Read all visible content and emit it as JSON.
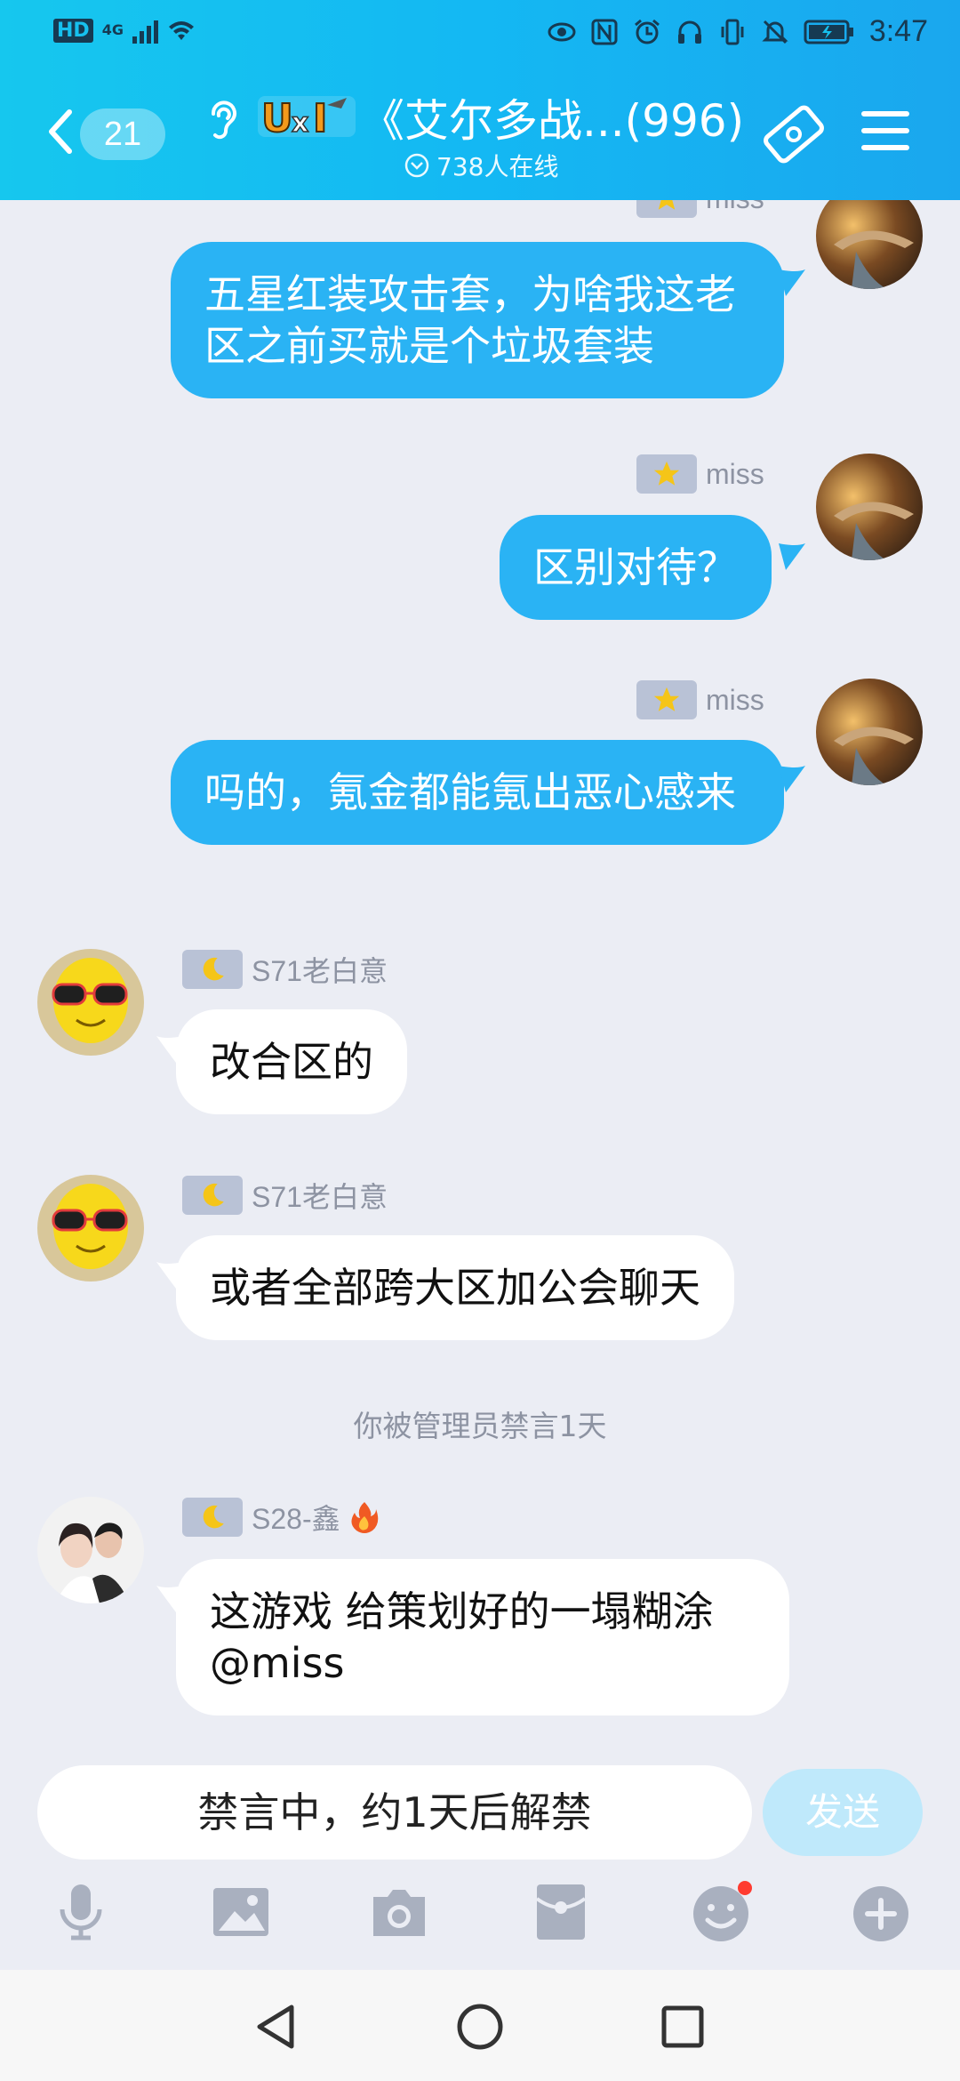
{
  "status_bar": {
    "network": "HD",
    "network_type": "4G",
    "time": "3:47",
    "icons": [
      "eye-icon",
      "nfc-icon",
      "alarm-icon",
      "headset-icon",
      "vibrate-icon",
      "mute-icon",
      "battery-icon"
    ]
  },
  "header": {
    "back_count": "21",
    "group_title": "《艾尔多战...(996)",
    "online_count": "738人在线",
    "icons": [
      "back-icon",
      "ear-icon",
      "group-logo",
      "ticket-icon",
      "menu-icon"
    ]
  },
  "messages": [
    {
      "side": "right",
      "sender": "miss",
      "badge": "star",
      "text": "五星红装攻击套，为啥我这老区之前买就是个垃圾套装"
    },
    {
      "side": "right",
      "sender": "miss",
      "badge": "star",
      "text": "区别对待？"
    },
    {
      "side": "right",
      "sender": "miss",
      "badge": "star",
      "text": "吗的，氪金都能氪出恶心感来"
    },
    {
      "side": "left",
      "sender": "S71老白意",
      "badge": "moon",
      "text": "改合区的"
    },
    {
      "side": "left",
      "sender": "S71老白意",
      "badge": "moon",
      "text": "或者全部跨大区加公会聊天"
    },
    {
      "side": "left",
      "sender": "S28-鑫",
      "badge": "moon",
      "extra_badge": "fire",
      "text": "这游戏 给策划好的一塌糊涂@miss"
    }
  ],
  "system_notice": "你被管理员禁言1天",
  "input": {
    "placeholder": "禁言中，约1天后解禁",
    "send_label": "发送"
  },
  "toolbar": [
    "mic-icon",
    "image-icon",
    "camera-icon",
    "red-packet-icon",
    "emoji-icon",
    "plus-icon"
  ],
  "colors": {
    "header": "#16c0ee",
    "outgoing_bubble": "#2ab3f4",
    "incoming_bubble": "#ffffff",
    "background": "#ebedf4"
  }
}
